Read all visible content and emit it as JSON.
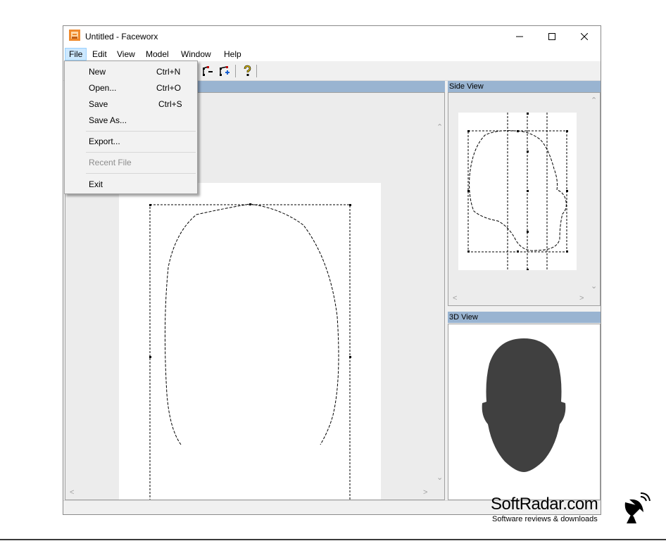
{
  "window": {
    "title": "Untitled - Faceworx",
    "controls": {
      "minimize": "minimize",
      "maximize": "maximize",
      "close": "close"
    }
  },
  "menubar": {
    "items": [
      {
        "label": "File"
      },
      {
        "label": "Edit"
      },
      {
        "label": "View"
      },
      {
        "label": "Model"
      },
      {
        "label": "Window"
      },
      {
        "label": "Help"
      }
    ],
    "active": "File"
  },
  "toolbar": {
    "icons": [
      "remove-point-icon",
      "add-point-icon",
      "help-icon"
    ]
  },
  "file_menu": {
    "items": [
      {
        "label": "New",
        "shortcut": "Ctrl+N",
        "enabled": true
      },
      {
        "label": "Open...",
        "shortcut": "Ctrl+O",
        "enabled": true
      },
      {
        "label": "Save",
        "shortcut": "Ctrl+S",
        "enabled": true
      },
      {
        "label": "Save As...",
        "shortcut": "",
        "enabled": true
      },
      {
        "label": "Export...",
        "shortcut": "",
        "enabled": true
      },
      {
        "label": "Recent File",
        "shortcut": "",
        "enabled": false
      },
      {
        "label": "Exit",
        "shortcut": "",
        "enabled": true
      }
    ]
  },
  "panels": {
    "side_view": {
      "caption": "Side View"
    },
    "view_3d": {
      "caption": "3D View"
    }
  },
  "watermark": {
    "brand": "SoftRadar.com",
    "tagline": "Software reviews & downloads"
  },
  "colors": {
    "panel_caption": "#99b4d1",
    "menu_highlight": "#cce8ff",
    "head_fill": "#404040",
    "app_icon": "#f08a2c"
  }
}
